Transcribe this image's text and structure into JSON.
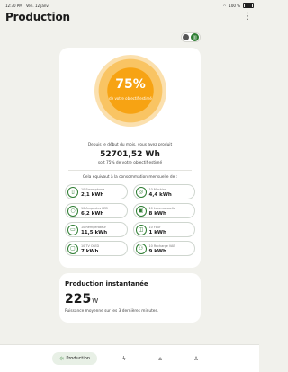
{
  "status": {
    "time": "12:30 PM",
    "date": "Ven. 12 janv.",
    "battery": "100 %"
  },
  "header": {
    "title": "Production"
  },
  "gauge": {
    "percent": "75%",
    "label": "de votre objectif estimé",
    "fill_fraction": 0.75
  },
  "summary": {
    "intro": "Depuis le début du mois, vous avez produit",
    "total": "52701,52 Wh",
    "percent_line": "soit 75% de votre objectif estimé"
  },
  "equivalents_title": "Cela équivaut à la consommation mensuelle de :",
  "equivalents": [
    {
      "icon": "phone-icon",
      "glyph": "▯",
      "label": "10 Smartphone",
      "value": "2,1 kWh"
    },
    {
      "icon": "washer-icon",
      "glyph": "◎",
      "label": "10 Machine",
      "value": "4,4 kWh"
    },
    {
      "icon": "bulb-icon",
      "glyph": "○",
      "label": "10 Ampoules LED",
      "value": "6,2 kWh"
    },
    {
      "icon": "dishwasher-icon",
      "glyph": "▣",
      "label": "10 Lave-vaisselle",
      "value": "8 kWh"
    },
    {
      "icon": "fridge-icon",
      "glyph": "▭",
      "label": "10 Réfrigérateur",
      "value": "11,5 kWh"
    },
    {
      "icon": "oven-icon",
      "glyph": "◫",
      "label": "10 Four",
      "value": "1 kWh"
    },
    {
      "icon": "tv-icon",
      "glyph": "▢",
      "label": "10 TV OLED",
      "value": "7 kWh"
    },
    {
      "icon": "ev-charger-icon",
      "glyph": "⚇",
      "label": "10 Recharge VAE",
      "value": "9 kWh"
    }
  ],
  "instant": {
    "title": "Production instantanée",
    "value": "225",
    "unit": "W",
    "subtitle": "Puissance moyenne sur les 3 dernières minutes."
  },
  "tabbar": {
    "active_label": "Production"
  },
  "colors": {
    "accent": "#2e7d32",
    "gauge": "#f7a313",
    "background": "#f1f1ec"
  }
}
